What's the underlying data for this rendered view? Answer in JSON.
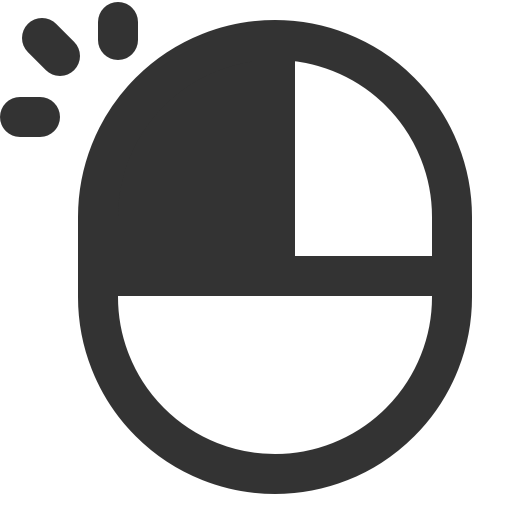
{
  "icon": {
    "name": "mouse-left-click-icon",
    "color": "#333333",
    "background": "#ffffff"
  }
}
